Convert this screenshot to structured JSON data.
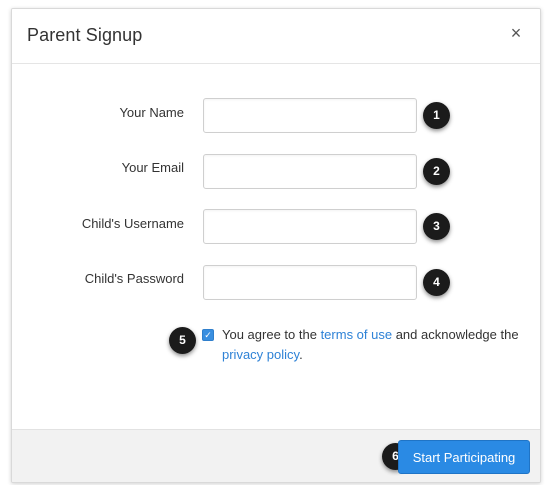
{
  "dialog": {
    "title": "Parent Signup",
    "close_label": "×"
  },
  "form": {
    "fields": [
      {
        "label": "Your Name",
        "value": "",
        "badge": "1"
      },
      {
        "label": "Your Email",
        "value": "",
        "badge": "2"
      },
      {
        "label": "Child's Username",
        "value": "",
        "badge": "3"
      },
      {
        "label": "Child's Password",
        "value": "",
        "badge": "4"
      }
    ],
    "agreement": {
      "checked": true,
      "check_glyph": "✓",
      "badge": "5",
      "text_before": "You agree to the ",
      "terms_link": "terms of use",
      "text_middle": " and acknowledge the ",
      "privacy_link": "privacy policy",
      "text_after": "."
    }
  },
  "footer": {
    "button_label": "Start Participating",
    "badge": "6"
  },
  "colors": {
    "accent": "#2a8ae4",
    "link": "#2e82d6",
    "badge": "#1b1b1b"
  }
}
